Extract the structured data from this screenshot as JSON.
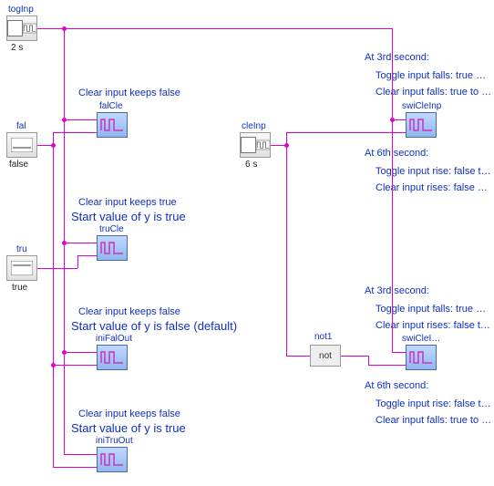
{
  "blocks": {
    "togInp": {
      "name": "togInp",
      "sub": "2 s"
    },
    "fal": {
      "name": "fal",
      "sub": "false"
    },
    "tru": {
      "name": "tru",
      "sub": "true"
    },
    "cleInp": {
      "name": "cleInp",
      "sub": "6 s"
    },
    "falCle": {
      "name": "falCle"
    },
    "truCle": {
      "name": "truCle"
    },
    "iniFalOut": {
      "name": "iniFalOut"
    },
    "iniTruOut": {
      "name": "iniTruOut"
    },
    "not1": {
      "name": "not1",
      "text": "not"
    },
    "swiCleInp": {
      "name": "swiCleInp"
    },
    "swiCleI": {
      "name": "swiCleI…"
    }
  },
  "annot": {
    "falCle_title": "Clear input keeps false",
    "truCle_title": "Clear input keeps true",
    "truCle_start": "Start value of y is true",
    "iniFalOut_title": "Clear input keeps false",
    "iniFalOut_start": "Start value of y is false (default)",
    "iniTruOut_title": "Clear input keeps false",
    "iniTruOut_start": "Start value of y is true",
    "r1_at3": "At 3rd second:",
    "r1_l1": "Toggle input falls: true …",
    "r1_l2": "Clear input falls: true to …",
    "r1_at6": "At 6th second:",
    "r1_l3": "Toggle input rise: false t…",
    "r1_l4": "Clear input rises: false …",
    "r2_at3": "At 3rd second:",
    "r2_l1": "Toggle input falls: true …",
    "r2_l2": "Clear input rises: false t…",
    "r2_at6": "At 6th second:",
    "r2_l3": "Toggle input rise: false t…",
    "r2_l4": "Clear input falls: true to …"
  }
}
